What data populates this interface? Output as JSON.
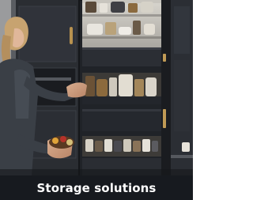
{
  "tile": {
    "caption": "Storage solutions",
    "image_subject": "Woman taking jars from a pull-out pantry drawer in a tall dark cabinet"
  },
  "colors": {
    "caption_background": "#171a1f",
    "caption_text": "#ffffff",
    "cabinet": "#23262c"
  }
}
